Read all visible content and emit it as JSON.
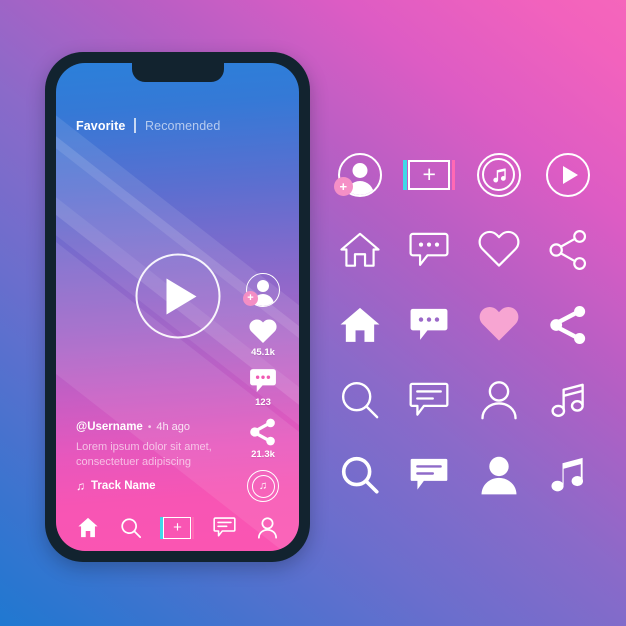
{
  "meta": {
    "title": "Social Media App UI Kit",
    "background_gradient_from": "#2b7ed0",
    "background_gradient_to": "#f262bd"
  },
  "phone": {
    "frame_color": "#12232f",
    "screen_gradient_from": "#2b80da",
    "screen_gradient_to": "#fb55b2",
    "tabs": {
      "active_label": "Favorite",
      "inactive_label": "Recomended"
    },
    "center_play": {
      "icon": "play-icon"
    },
    "action_rail": [
      {
        "icon": "add-user-avatar-icon",
        "badge": "+",
        "count": ""
      },
      {
        "icon": "heart-filled-icon",
        "badge": "",
        "count": "45.1k"
      },
      {
        "icon": "comment-dots-filled-icon",
        "badge": "",
        "count": "123"
      },
      {
        "icon": "share-filled-icon",
        "badge": "",
        "count": "21.3k"
      },
      {
        "icon": "music-disc-icon",
        "badge": "",
        "count": ""
      }
    ],
    "caption": {
      "username": "@Username",
      "dot": "•",
      "timeago": "4h ago",
      "description": "Lorem ipsum dolor sit amet, consectetuer adipiscing",
      "track_note_glyph": "♫",
      "track_name": "Track Name"
    },
    "bottom_nav": [
      {
        "icon": "home-filled-icon",
        "label": "Home"
      },
      {
        "icon": "search-outline-icon",
        "label": "Search"
      },
      {
        "icon": "add-post-icon",
        "label": "Add Post",
        "plus": "+"
      },
      {
        "icon": "comment-lines-outline-icon",
        "label": "Messages"
      },
      {
        "icon": "person-outline-icon",
        "label": "Profile"
      }
    ]
  },
  "icon_grid": {
    "columns": 4,
    "rows": 5,
    "accent_cyan": "#3fd9e8",
    "accent_pink": "#ff69b4",
    "heart_pink": "#f7a5d2",
    "items": [
      {
        "icon": "add-user-avatar-icon",
        "label": "Add User",
        "badge": "+"
      },
      {
        "icon": "add-post-icon",
        "label": "Add Post",
        "plus": "+"
      },
      {
        "icon": "music-disc-icon",
        "label": "Music Disc"
      },
      {
        "icon": "play-circle-icon",
        "label": "Play"
      },
      {
        "icon": "home-outline-icon",
        "label": "Home Outline"
      },
      {
        "icon": "comment-dots-outline-icon",
        "label": "Comment Outline"
      },
      {
        "icon": "heart-outline-icon",
        "label": "Heart Outline"
      },
      {
        "icon": "share-outline-icon",
        "label": "Share Outline"
      },
      {
        "icon": "home-filled-icon",
        "label": "Home Filled"
      },
      {
        "icon": "comment-dots-filled-icon",
        "label": "Comment Filled"
      },
      {
        "icon": "heart-filled-pink-icon",
        "label": "Heart Filled Pink"
      },
      {
        "icon": "share-filled-icon",
        "label": "Share Filled"
      },
      {
        "icon": "search-outline-icon",
        "label": "Search Outline"
      },
      {
        "icon": "comment-lines-outline-icon",
        "label": "Message Outline"
      },
      {
        "icon": "person-outline-icon",
        "label": "Person Outline"
      },
      {
        "icon": "music-note-outline-icon",
        "label": "Music Note Outline"
      },
      {
        "icon": "search-bold-icon",
        "label": "Search Bold"
      },
      {
        "icon": "comment-lines-filled-icon",
        "label": "Message Filled"
      },
      {
        "icon": "person-filled-icon",
        "label": "Person Filled"
      },
      {
        "icon": "music-note-filled-icon",
        "label": "Music Note Filled"
      }
    ]
  }
}
